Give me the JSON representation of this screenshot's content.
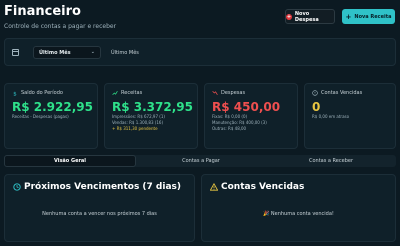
{
  "header": {
    "title": "Financeiro",
    "subtitle": "Controle de contas a pagar e receber"
  },
  "actions": {
    "new_expense": "Novo Despesa",
    "new_revenue": "Nova Receita"
  },
  "filter": {
    "selected": "Último Mês",
    "period_label": "Último Mês"
  },
  "cards": {
    "saldo": {
      "label": "Saldo do Período",
      "value": "R$ 2.922,95",
      "note": "Receitas - Despesas (pagas)"
    },
    "receitas": {
      "label": "Receitas",
      "value": "R$ 3.372,95",
      "line1": "Impressões: R$ 672,97 (1)",
      "line2": "Vendas: R$ 1.300,83 (16)",
      "pending": "+ R$ 311,30 pendente"
    },
    "despesas": {
      "label": "Despesas",
      "value": "R$ 450,00",
      "line1": "Fixas: R$ 0,00 (0)",
      "line2": "Manutenção: R$ 400,00 (3)",
      "line3": "Outras: R$ 48,00"
    },
    "vencidas": {
      "label": "Contas Vencidas",
      "value": "0",
      "note": "R$ 0,00 em atraso"
    }
  },
  "tabs": [
    "Visão Geral",
    "Contas a Pagar",
    "Contas a Receber"
  ],
  "panels": {
    "proximos": {
      "title": "Próximos Vencimentos (7 dias)",
      "empty": "Nenhuma conta a vencer nos próximos 7 dias"
    },
    "vencidas": {
      "title": "Contas Vencidas",
      "empty": "🎉 Nenhuma conta vencida!"
    }
  },
  "colors": {
    "accent": "#2fc2c8",
    "positive": "#2ee08a",
    "negative": "#ef4f4f",
    "warning": "#e8c541",
    "background": "#0c1a22"
  },
  "icons": [
    "plus-circle-icon",
    "plus-icon",
    "calendar-icon",
    "chevron-down-icon",
    "dollar-icon",
    "trending-up-icon",
    "trending-down-icon",
    "alert-icon",
    "clock-icon",
    "warning-icon"
  ]
}
